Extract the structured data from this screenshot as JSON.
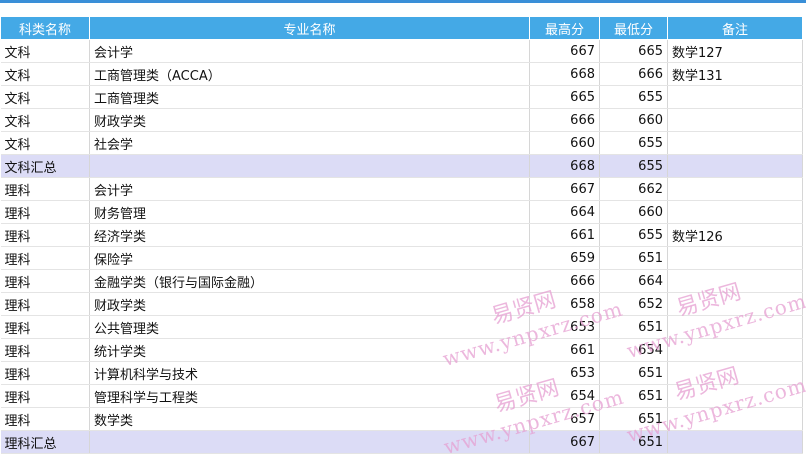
{
  "table": {
    "headers": [
      "科类名称",
      "专业名称",
      "最高分",
      "最低分",
      "备注"
    ],
    "rows": [
      {
        "category": "文科",
        "major": "会计学",
        "max": "667",
        "min": "665",
        "note": "数学127",
        "summary": false
      },
      {
        "category": "文科",
        "major": "工商管理类（ACCA）",
        "max": "668",
        "min": "666",
        "note": "数学131",
        "summary": false
      },
      {
        "category": "文科",
        "major": "工商管理类",
        "max": "665",
        "min": "655",
        "note": "",
        "summary": false
      },
      {
        "category": "文科",
        "major": "财政学类",
        "max": "666",
        "min": "660",
        "note": "",
        "summary": false
      },
      {
        "category": "文科",
        "major": "社会学",
        "max": "660",
        "min": "655",
        "note": "",
        "summary": false
      },
      {
        "category": "文科汇总",
        "major": "",
        "max": "668",
        "min": "655",
        "note": "",
        "summary": true
      },
      {
        "category": "理科",
        "major": "会计学",
        "max": "667",
        "min": "662",
        "note": "",
        "summary": false
      },
      {
        "category": "理科",
        "major": "财务管理",
        "max": "664",
        "min": "660",
        "note": "",
        "summary": false
      },
      {
        "category": "理科",
        "major": "经济学类",
        "max": "661",
        "min": "655",
        "note": "数学126",
        "summary": false
      },
      {
        "category": "理科",
        "major": "保险学",
        "max": "659",
        "min": "651",
        "note": "",
        "summary": false
      },
      {
        "category": "理科",
        "major": "金融学类（银行与国际金融）",
        "max": "666",
        "min": "664",
        "note": "",
        "summary": false
      },
      {
        "category": "理科",
        "major": "财政学类",
        "max": "658",
        "min": "652",
        "note": "",
        "summary": false
      },
      {
        "category": "理科",
        "major": "公共管理类",
        "max": "653",
        "min": "651",
        "note": "",
        "summary": false
      },
      {
        "category": "理科",
        "major": "统计学类",
        "max": "661",
        "min": "654",
        "note": "",
        "summary": false
      },
      {
        "category": "理科",
        "major": "计算机科学与技术",
        "max": "653",
        "min": "651",
        "note": "",
        "summary": false
      },
      {
        "category": "理科",
        "major": "管理科学与工程类",
        "max": "654",
        "min": "651",
        "note": "",
        "summary": false
      },
      {
        "category": "理科",
        "major": "数学类",
        "max": "657",
        "min": "651",
        "note": "",
        "summary": false
      },
      {
        "category": "理科汇总",
        "major": "",
        "max": "667",
        "min": "651",
        "note": "",
        "summary": true
      }
    ]
  },
  "watermarks": {
    "brand": "易贤网",
    "url": "www.ynpxrz.com"
  },
  "colors": {
    "header_bg": "#44a9e6",
    "summary_bg": "#dcdcf6",
    "watermark": "#e6a0d2"
  }
}
